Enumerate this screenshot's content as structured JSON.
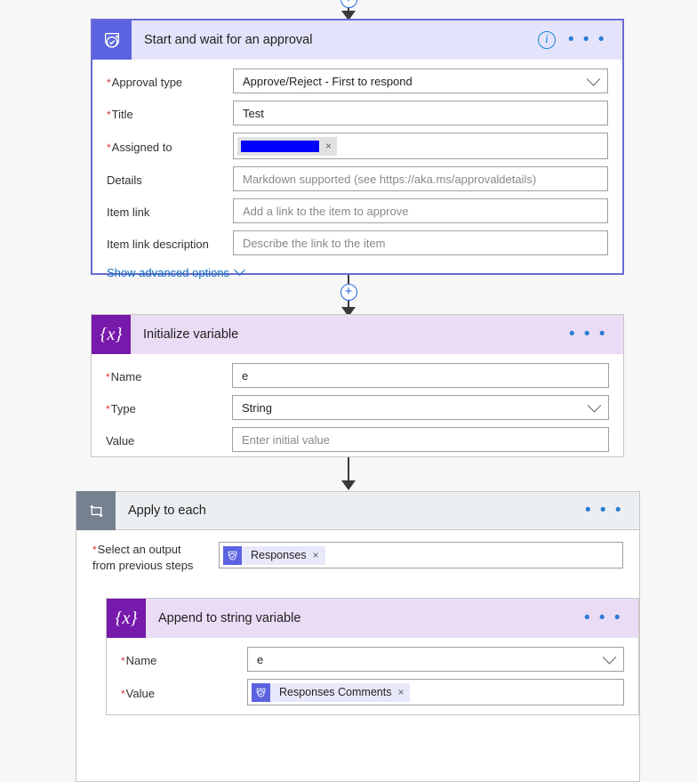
{
  "flow": {
    "nodes": [
      {
        "id": "approval",
        "title": "Start and wait for an approval",
        "icon": "approval-badge-icon",
        "selected": true,
        "has_info_icon": true,
        "menu": "• • •",
        "fields": [
          {
            "label": "Approval type",
            "required": true,
            "control": "dropdown",
            "value": "Approve/Reject - First to respond",
            "is_placeholder": false
          },
          {
            "label": "Title",
            "required": true,
            "control": "text",
            "value": "Test",
            "is_placeholder": false
          },
          {
            "label": "Assigned to",
            "required": true,
            "control": "token-redacted",
            "value": "",
            "is_placeholder": false
          },
          {
            "label": "Details",
            "required": false,
            "control": "text",
            "value": "Markdown supported (see https://aka.ms/approvaldetails)",
            "is_placeholder": true
          },
          {
            "label": "Item link",
            "required": false,
            "control": "text",
            "value": "Add a link to the item to approve",
            "is_placeholder": true
          },
          {
            "label": "Item link description",
            "required": false,
            "control": "text",
            "value": "Describe the link to the item",
            "is_placeholder": true
          }
        ],
        "advanced_link": "Show advanced options"
      },
      {
        "id": "initialize-variable",
        "title": "Initialize variable",
        "icon": "variable-braces-icon",
        "selected": false,
        "has_info_icon": false,
        "menu": "• • •",
        "fields": [
          {
            "label": "Name",
            "required": true,
            "control": "text",
            "value": "e",
            "is_placeholder": false
          },
          {
            "label": "Type",
            "required": true,
            "control": "dropdown",
            "value": "String",
            "is_placeholder": false
          },
          {
            "label": "Value",
            "required": false,
            "control": "text",
            "value": "Enter initial value",
            "is_placeholder": true
          }
        ]
      },
      {
        "id": "apply-to-each",
        "title": "Apply to each",
        "icon": "loop-icon",
        "menu": "• • •",
        "select_output": {
          "label_line1": "Select an output",
          "label_line2": "from previous steps",
          "required": true,
          "token": "Responses"
        },
        "child": {
          "id": "append-to-string-variable",
          "title": "Append to string variable",
          "icon": "variable-braces-icon",
          "menu": "• • •",
          "fields": [
            {
              "label": "Name",
              "required": true,
              "control": "dropdown",
              "value": "e",
              "is_placeholder": false
            },
            {
              "label": "Value",
              "required": true,
              "control": "token-ref",
              "value": "Responses Comments",
              "is_placeholder": false
            }
          ]
        }
      }
    ],
    "connectors": [
      {
        "id": "conn-top",
        "has_plus": true
      },
      {
        "id": "conn-approval-to-variable",
        "has_plus": true
      },
      {
        "id": "conn-variable-to-loop",
        "has_plus": false
      }
    ],
    "icons": {
      "info": "i",
      "remove_token": "×",
      "plus": "+"
    },
    "colors": {
      "approval_accent": "#5b63e0",
      "variable_accent": "#7719aa",
      "loop_accent": "#76818f",
      "link": "#0f6cbd",
      "required": "#d13438",
      "redaction": "#0000ff",
      "selection_border": "#6b6bd6"
    }
  }
}
